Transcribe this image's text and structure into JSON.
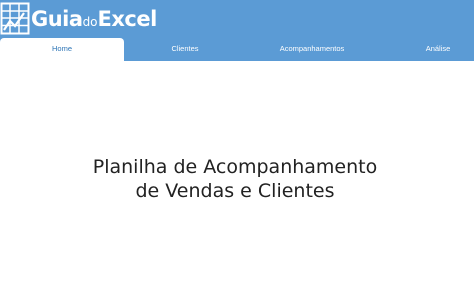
{
  "logo": {
    "part1": "Guia",
    "part2": "do",
    "part3": "Excel",
    "icon": "spreadsheet-icon"
  },
  "tabs": [
    {
      "label": "Home",
      "active": true
    },
    {
      "label": "Clientes",
      "active": false
    },
    {
      "label": "Acompanhamentos",
      "active": false
    },
    {
      "label": "Análise",
      "active": false
    }
  ],
  "main": {
    "title_line1": "Planilha de Acompanhamento",
    "title_line2": "de Vendas e Clientes"
  },
  "colors": {
    "header": "#5b9bd5",
    "active_tab_text": "#2e75b6",
    "background": "#ffffff"
  }
}
